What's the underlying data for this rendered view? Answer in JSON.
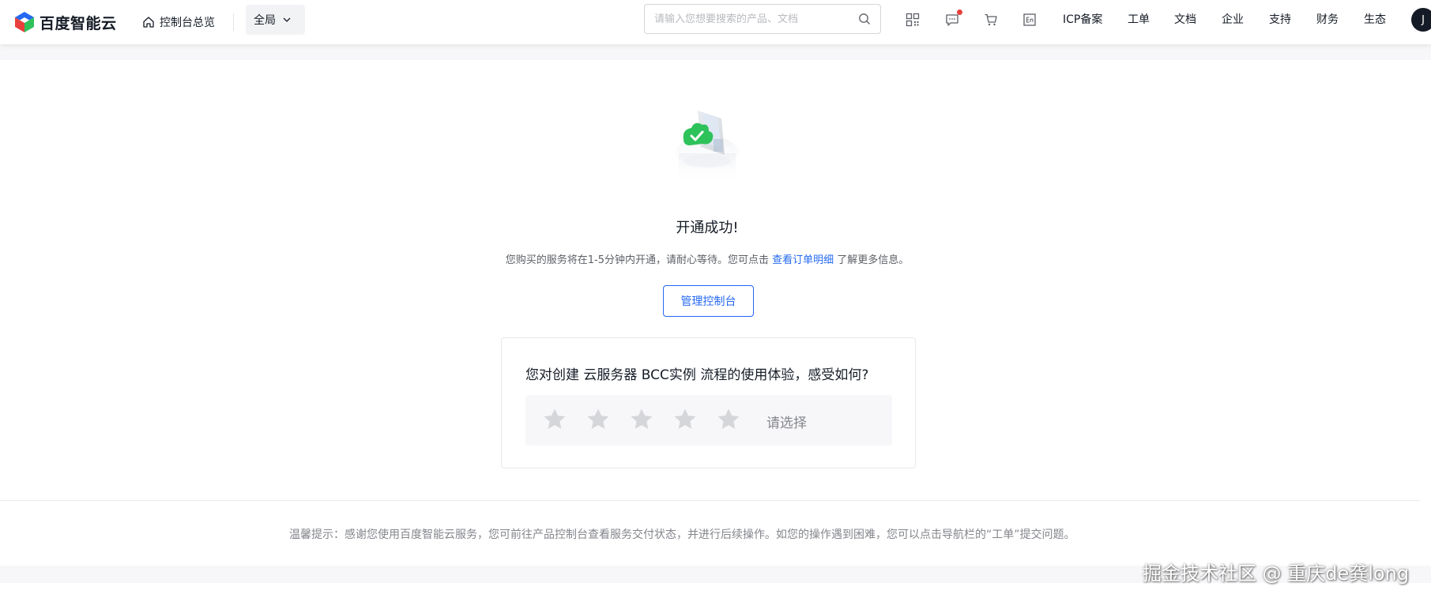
{
  "header": {
    "brand": "百度智能云",
    "home_label": "控制台总览",
    "region_label": "全局",
    "search_placeholder": "请输入您想要搜索的产品、文档",
    "icons": [
      "qrcode-icon",
      "message-icon",
      "cart-icon",
      "language-icon"
    ],
    "nav_links": [
      "ICP备案",
      "工单",
      "文档",
      "企业",
      "支持",
      "财务",
      "生态"
    ],
    "avatar_letter": "J",
    "message_badge": true
  },
  "main": {
    "success_title": "开通成功!",
    "desc_before": "您购买的服务将在1-5分钟内开通，请耐心等待。您可点击 ",
    "desc_link": "查看订单明细",
    "desc_after": " 了解更多信息。",
    "manage_button": "管理控制台"
  },
  "survey": {
    "question": "您对创建 云服务器 BCC实例 流程的使用体验，感受如何?",
    "star_count": 5,
    "rating_hint": "请选择"
  },
  "footer": {
    "tip": "温馨提示：感谢您使用百度智能云服务，您可前往产品控制台查看服务交付状态，并进行后续操作。如您的操作遇到困难，您可以点击导航栏的“工单”提交问题。"
  },
  "watermark": "掘金技术社区 @ 重庆de龚long",
  "colors": {
    "accent": "#2468f2",
    "success_green": "#2ec25b",
    "badge_red": "#e8403c",
    "text_primary": "#151b26",
    "text_secondary": "#84868c"
  }
}
